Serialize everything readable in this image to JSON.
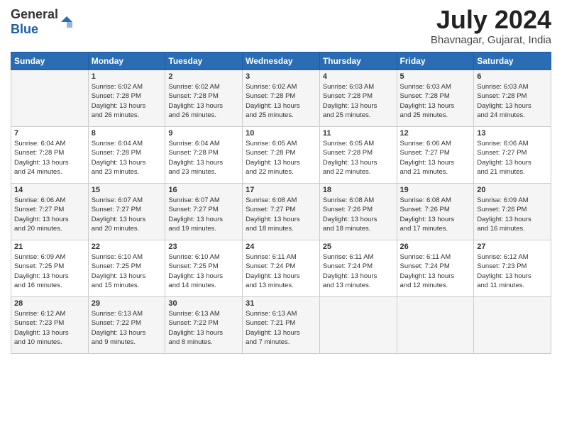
{
  "header": {
    "logo_general": "General",
    "logo_blue": "Blue",
    "month_title": "July 2024",
    "location": "Bhavnagar, Gujarat, India"
  },
  "days_of_week": [
    "Sunday",
    "Monday",
    "Tuesday",
    "Wednesday",
    "Thursday",
    "Friday",
    "Saturday"
  ],
  "weeks": [
    [
      {
        "day": "",
        "info": ""
      },
      {
        "day": "1",
        "info": "Sunrise: 6:02 AM\nSunset: 7:28 PM\nDaylight: 13 hours\nand 26 minutes."
      },
      {
        "day": "2",
        "info": "Sunrise: 6:02 AM\nSunset: 7:28 PM\nDaylight: 13 hours\nand 26 minutes."
      },
      {
        "day": "3",
        "info": "Sunrise: 6:02 AM\nSunset: 7:28 PM\nDaylight: 13 hours\nand 25 minutes."
      },
      {
        "day": "4",
        "info": "Sunrise: 6:03 AM\nSunset: 7:28 PM\nDaylight: 13 hours\nand 25 minutes."
      },
      {
        "day": "5",
        "info": "Sunrise: 6:03 AM\nSunset: 7:28 PM\nDaylight: 13 hours\nand 25 minutes."
      },
      {
        "day": "6",
        "info": "Sunrise: 6:03 AM\nSunset: 7:28 PM\nDaylight: 13 hours\nand 24 minutes."
      }
    ],
    [
      {
        "day": "7",
        "info": "Sunrise: 6:04 AM\nSunset: 7:28 PM\nDaylight: 13 hours\nand 24 minutes."
      },
      {
        "day": "8",
        "info": "Sunrise: 6:04 AM\nSunset: 7:28 PM\nDaylight: 13 hours\nand 23 minutes."
      },
      {
        "day": "9",
        "info": "Sunrise: 6:04 AM\nSunset: 7:28 PM\nDaylight: 13 hours\nand 23 minutes."
      },
      {
        "day": "10",
        "info": "Sunrise: 6:05 AM\nSunset: 7:28 PM\nDaylight: 13 hours\nand 22 minutes."
      },
      {
        "day": "11",
        "info": "Sunrise: 6:05 AM\nSunset: 7:28 PM\nDaylight: 13 hours\nand 22 minutes."
      },
      {
        "day": "12",
        "info": "Sunrise: 6:06 AM\nSunset: 7:27 PM\nDaylight: 13 hours\nand 21 minutes."
      },
      {
        "day": "13",
        "info": "Sunrise: 6:06 AM\nSunset: 7:27 PM\nDaylight: 13 hours\nand 21 minutes."
      }
    ],
    [
      {
        "day": "14",
        "info": "Sunrise: 6:06 AM\nSunset: 7:27 PM\nDaylight: 13 hours\nand 20 minutes."
      },
      {
        "day": "15",
        "info": "Sunrise: 6:07 AM\nSunset: 7:27 PM\nDaylight: 13 hours\nand 20 minutes."
      },
      {
        "day": "16",
        "info": "Sunrise: 6:07 AM\nSunset: 7:27 PM\nDaylight: 13 hours\nand 19 minutes."
      },
      {
        "day": "17",
        "info": "Sunrise: 6:08 AM\nSunset: 7:27 PM\nDaylight: 13 hours\nand 18 minutes."
      },
      {
        "day": "18",
        "info": "Sunrise: 6:08 AM\nSunset: 7:26 PM\nDaylight: 13 hours\nand 18 minutes."
      },
      {
        "day": "19",
        "info": "Sunrise: 6:08 AM\nSunset: 7:26 PM\nDaylight: 13 hours\nand 17 minutes."
      },
      {
        "day": "20",
        "info": "Sunrise: 6:09 AM\nSunset: 7:26 PM\nDaylight: 13 hours\nand 16 minutes."
      }
    ],
    [
      {
        "day": "21",
        "info": "Sunrise: 6:09 AM\nSunset: 7:25 PM\nDaylight: 13 hours\nand 16 minutes."
      },
      {
        "day": "22",
        "info": "Sunrise: 6:10 AM\nSunset: 7:25 PM\nDaylight: 13 hours\nand 15 minutes."
      },
      {
        "day": "23",
        "info": "Sunrise: 6:10 AM\nSunset: 7:25 PM\nDaylight: 13 hours\nand 14 minutes."
      },
      {
        "day": "24",
        "info": "Sunrise: 6:11 AM\nSunset: 7:24 PM\nDaylight: 13 hours\nand 13 minutes."
      },
      {
        "day": "25",
        "info": "Sunrise: 6:11 AM\nSunset: 7:24 PM\nDaylight: 13 hours\nand 13 minutes."
      },
      {
        "day": "26",
        "info": "Sunrise: 6:11 AM\nSunset: 7:24 PM\nDaylight: 13 hours\nand 12 minutes."
      },
      {
        "day": "27",
        "info": "Sunrise: 6:12 AM\nSunset: 7:23 PM\nDaylight: 13 hours\nand 11 minutes."
      }
    ],
    [
      {
        "day": "28",
        "info": "Sunrise: 6:12 AM\nSunset: 7:23 PM\nDaylight: 13 hours\nand 10 minutes."
      },
      {
        "day": "29",
        "info": "Sunrise: 6:13 AM\nSunset: 7:22 PM\nDaylight: 13 hours\nand 9 minutes."
      },
      {
        "day": "30",
        "info": "Sunrise: 6:13 AM\nSunset: 7:22 PM\nDaylight: 13 hours\nand 8 minutes."
      },
      {
        "day": "31",
        "info": "Sunrise: 6:13 AM\nSunset: 7:21 PM\nDaylight: 13 hours\nand 7 minutes."
      },
      {
        "day": "",
        "info": ""
      },
      {
        "day": "",
        "info": ""
      },
      {
        "day": "",
        "info": ""
      }
    ]
  ]
}
